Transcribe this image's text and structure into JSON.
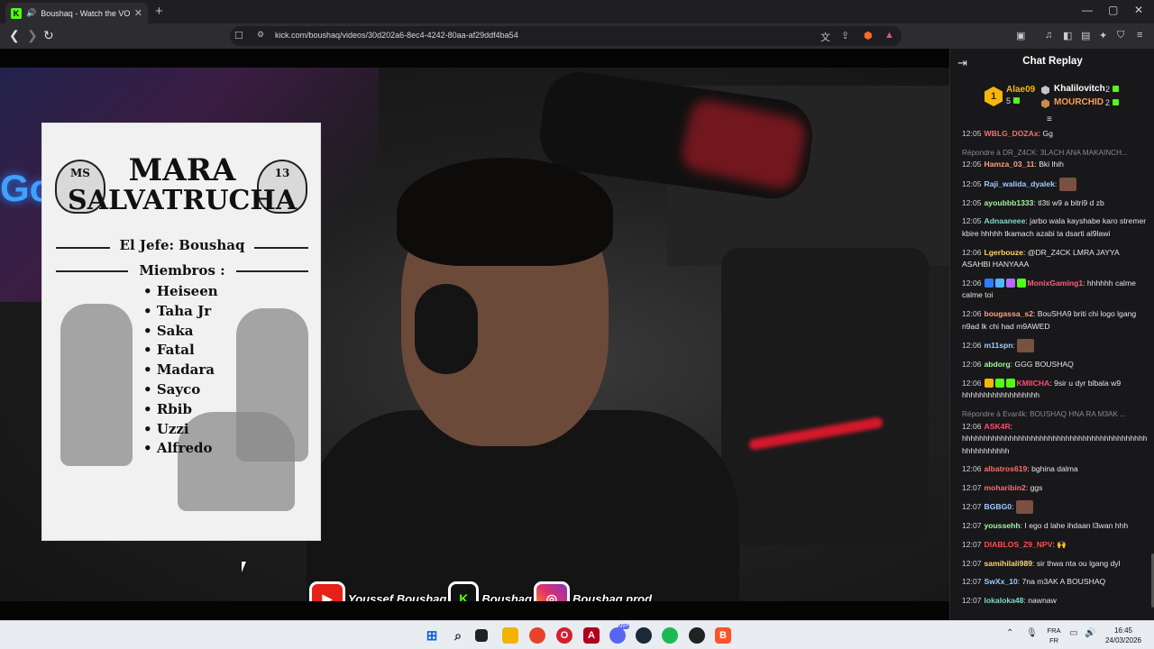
{
  "browser": {
    "tab_title": "Boushaq - Watch the VOD on Kick",
    "tab_close": "✕",
    "new_tab": "+",
    "url": "kick.com/boushaq/videos/30d202a6-8ec4-4242-80aa-af29ddf4ba54",
    "window_controls": {
      "minimize": "—",
      "maximize": "▢",
      "close": "✕"
    }
  },
  "video": {
    "poster": {
      "title_line1": "MARA",
      "title_line2": "SALVATRUCHA",
      "skull_left": "MS",
      "skull_right": "13",
      "jefe": "El Jefe: Boushaq",
      "members_heading": "Miembros :",
      "members": [
        "Heiseen",
        "Taha Jr",
        "Saka",
        "Fatal",
        "Madara",
        "Sayco",
        "Rbib",
        "Uzzi",
        "Alfredo"
      ]
    },
    "socials": {
      "youtube": "Youssef Boushaq",
      "kick": "Boushaq",
      "instagram": "Boushaq.prod"
    }
  },
  "chat": {
    "title": "Chat Replay",
    "leaderboard": {
      "first": {
        "rank": "1",
        "name": "Alae09",
        "count": "5"
      },
      "second": {
        "name": "Khalilovitch",
        "count": "2"
      },
      "third": {
        "name": "MOURCHID",
        "count": "2"
      }
    },
    "messages": [
      {
        "time": "12:05",
        "user": "WBLG_DOZAx",
        "color": "#ff6b6b",
        "text": "Gg"
      },
      {
        "reply": "Répondre à DR_Z4CK: 3LACH ANA MAKAINCH..."
      },
      {
        "time": "12:05",
        "user": "Hamza_03_11",
        "color": "#ff9e80",
        "text": "Bki lhih"
      },
      {
        "time": "12:05",
        "user": "Raji_walida_dyalek",
        "color": "#9ecbff",
        "text": "",
        "emote": true
      },
      {
        "time": "12:05",
        "user": "ayoubbb1333",
        "color": "#a6f0a0",
        "text": "tl3ti w9 a bitri9 d zb"
      },
      {
        "time": "12:05",
        "user": "Adnaaneee",
        "color": "#7fd8c8",
        "text": "jarbo wala kayshabe karo stremer kbire hhhhh tkamach azabi ta dsarti al9lawi"
      },
      {
        "time": "12:06",
        "user": "Lgerbouze",
        "color": "#ffd36b",
        "text": "@DR_Z4CK LMRA JAYYA ASAHBI HANYAAA"
      },
      {
        "time": "12:06",
        "user": "MonixGaming1",
        "color": "#ff5e7a",
        "text": "hhhhhh calme calme toi",
        "badges": [
          "#2d7dff",
          "#4fb7ff",
          "#b56cff",
          "#53fc18"
        ]
      },
      {
        "time": "12:06",
        "user": "bougassa_s2",
        "color": "#ff9e80",
        "text": "BouSHA9 briti chi logo lgang n9ad lk chi had m9AWED"
      },
      {
        "time": "12:06",
        "user": "m11spn",
        "color": "#9ecbff",
        "text": "",
        "emote": true
      },
      {
        "time": "12:06",
        "user": "abdorg",
        "color": "#a6f0a0",
        "text": "GGG BOUSHAQ"
      },
      {
        "time": "12:06",
        "user": "KMIICHA",
        "color": "#ff4d6d",
        "text": "9sir u dyr blbala w9 hhhhhhhhhhhhhhhhhh",
        "badges": [
          "#f5b70a",
          "#53fc18",
          "#53fc18"
        ]
      },
      {
        "reply": "Répondre à Evar4k: BOUSHAQ HNA RA M3AK ..."
      },
      {
        "time": "12:06",
        "user": "ASK4R",
        "color": "#ff4d6d",
        "text": "hhhhhhhhhhhhhhhhhhhhhhhhhhhhhhhhhhhhhhhhhhhhhhhhhhhhhh"
      },
      {
        "time": "12:06",
        "user": "albatros619",
        "color": "#ff6b6b",
        "text": "bghina dalma"
      },
      {
        "time": "12:07",
        "user": "moharibin2",
        "color": "#ff6b6b",
        "text": "ggs"
      },
      {
        "time": "12:07",
        "user": "BGBG0",
        "color": "#9ecbff",
        "text": "",
        "emote": true
      },
      {
        "time": "12:07",
        "user": "youssehh",
        "color": "#a6f0a0",
        "text": "I ego d lahe ihdaan l3wan hhh"
      },
      {
        "time": "12:07",
        "user": "DIABLOS_Z9_NPV",
        "color": "#ff4d4d",
        "text": "🙌"
      },
      {
        "time": "12:07",
        "user": "samihilali989",
        "color": "#ffd36b",
        "text": "sir thwa nta ou lgang dyl"
      },
      {
        "time": "12:07",
        "user": "SwXx_10",
        "color": "#9ecbff",
        "text": "7na m3AK A BOUSHAQ"
      },
      {
        "time": "12:07",
        "user": "lokaloka48",
        "color": "#7fd8c8",
        "text": "nawnaw"
      }
    ]
  },
  "taskbar": {
    "lang_top": "FRA",
    "lang_bottom": "FR",
    "time": "16:45",
    "date": "24/03/2026",
    "notif_badge": "99+"
  }
}
